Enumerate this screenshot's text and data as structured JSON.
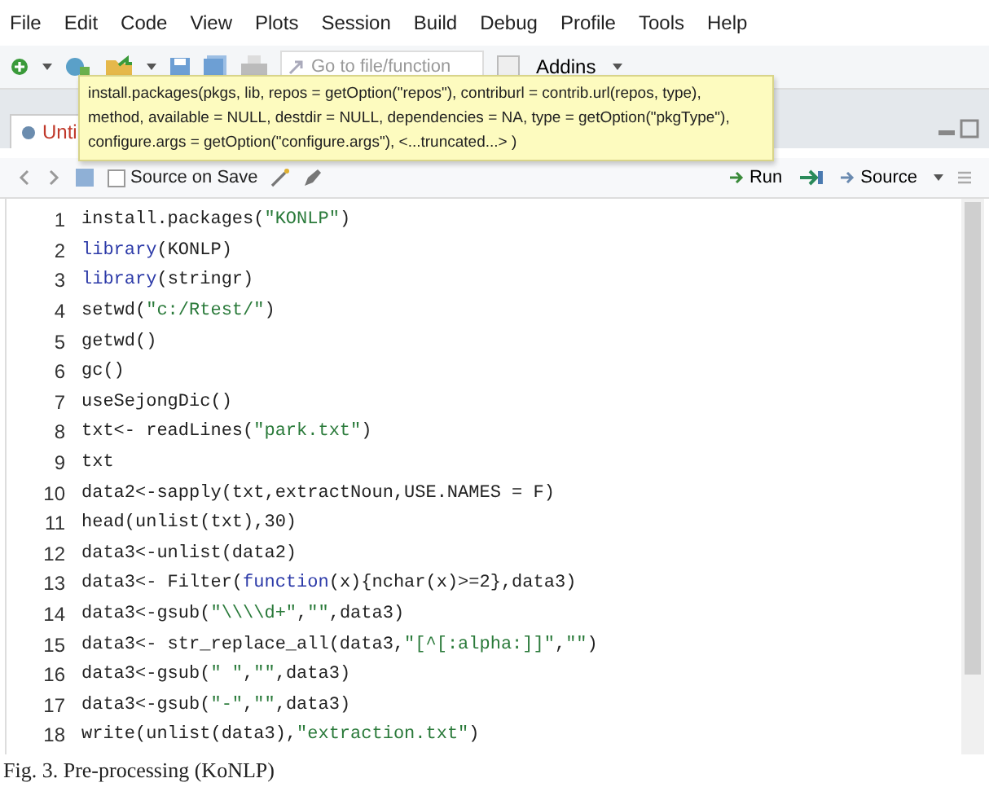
{
  "menu": [
    "File",
    "Edit",
    "Code",
    "View",
    "Plots",
    "Session",
    "Build",
    "Debug",
    "Profile",
    "Tools",
    "Help"
  ],
  "toolbar": {
    "search_placeholder": "Go to file/function",
    "addins": "Addins"
  },
  "tab": {
    "label": "Unti",
    "selected": true
  },
  "tooltip": [
    "install.packages(pkgs, lib, repos = getOption(\"repos\"), contriburl = contrib.url(repos, type),",
    "method, available = NULL, destdir = NULL, dependencies = NA, type = getOption(\"pkgType\"),",
    "configure.args = getOption(\"configure.args\"), <...truncated...> )"
  ],
  "editor_toolbar": {
    "source_on_save": "Source on Save",
    "source_on_save_checked": false,
    "run": "Run",
    "source": "Source"
  },
  "lines": [
    {
      "number": "1",
      "segments": [
        {
          "kind": "plain",
          "text": "install.packages("
        },
        {
          "kind": "string",
          "text": "\"KONLP\""
        },
        {
          "kind": "plain",
          "text": ")"
        }
      ]
    },
    {
      "number": "2",
      "segments": [
        {
          "kind": "keyword",
          "text": "library"
        },
        {
          "kind": "plain",
          "text": "(KONLP)"
        }
      ]
    },
    {
      "number": "3",
      "segments": [
        {
          "kind": "keyword",
          "text": "library"
        },
        {
          "kind": "plain",
          "text": "(stringr)"
        }
      ]
    },
    {
      "number": "4",
      "segments": [
        {
          "kind": "plain",
          "text": "setwd("
        },
        {
          "kind": "string",
          "text": "\"c:/Rtest/\""
        },
        {
          "kind": "plain",
          "text": ")"
        }
      ]
    },
    {
      "number": "5",
      "segments": [
        {
          "kind": "plain",
          "text": "getwd()"
        }
      ]
    },
    {
      "number": "6",
      "segments": [
        {
          "kind": "plain",
          "text": "gc()"
        }
      ]
    },
    {
      "number": "7",
      "segments": [
        {
          "kind": "plain",
          "text": "useSejongDic()"
        }
      ]
    },
    {
      "number": "8",
      "segments": [
        {
          "kind": "plain",
          "text": "txt<- readLines("
        },
        {
          "kind": "string",
          "text": "\"park.txt\""
        },
        {
          "kind": "plain",
          "text": ")"
        }
      ]
    },
    {
      "number": "9",
      "segments": [
        {
          "kind": "plain",
          "text": "txt"
        }
      ]
    },
    {
      "number": "10",
      "segments": [
        {
          "kind": "plain",
          "text": "data2<-sapply(txt,extractNoun,USE.NAMES = F)"
        }
      ]
    },
    {
      "number": "11",
      "segments": [
        {
          "kind": "plain",
          "text": "head(unlist(txt),30)"
        }
      ]
    },
    {
      "number": "12",
      "segments": [
        {
          "kind": "plain",
          "text": "data3<-unlist(data2)"
        }
      ]
    },
    {
      "number": "13",
      "segments": [
        {
          "kind": "plain",
          "text": "data3<- Filter("
        },
        {
          "kind": "keyword",
          "text": "function"
        },
        {
          "kind": "plain",
          "text": "(x){nchar(x)>=2},data3)"
        }
      ]
    },
    {
      "number": "14",
      "segments": [
        {
          "kind": "plain",
          "text": "data3<-gsub("
        },
        {
          "kind": "string",
          "text": "\"\\\\\\\\d+\""
        },
        {
          "kind": "plain",
          "text": ","
        },
        {
          "kind": "string",
          "text": "\"\""
        },
        {
          "kind": "plain",
          "text": ",data3)"
        }
      ]
    },
    {
      "number": "15",
      "segments": [
        {
          "kind": "plain",
          "text": "data3<- str_replace_all(data3,"
        },
        {
          "kind": "string",
          "text": "\"[^[:alpha:]]\""
        },
        {
          "kind": "plain",
          "text": ","
        },
        {
          "kind": "string",
          "text": "\"\""
        },
        {
          "kind": "plain",
          "text": ")"
        }
      ]
    },
    {
      "number": "16",
      "segments": [
        {
          "kind": "plain",
          "text": "data3<-gsub("
        },
        {
          "kind": "string",
          "text": "\" \""
        },
        {
          "kind": "plain",
          "text": ","
        },
        {
          "kind": "string",
          "text": "\"\""
        },
        {
          "kind": "plain",
          "text": ",data3)"
        }
      ]
    },
    {
      "number": "17",
      "segments": [
        {
          "kind": "plain",
          "text": "data3<-gsub("
        },
        {
          "kind": "string",
          "text": "\"-\""
        },
        {
          "kind": "plain",
          "text": ","
        },
        {
          "kind": "string",
          "text": "\"\""
        },
        {
          "kind": "plain",
          "text": ",data3)"
        }
      ]
    },
    {
      "number": "18",
      "segments": [
        {
          "kind": "plain",
          "text": "write(unlist(data3),"
        },
        {
          "kind": "string",
          "text": "\"extraction.txt\""
        },
        {
          "kind": "plain",
          "text": ")"
        }
      ]
    }
  ],
  "caption": "Fig. 3. Pre-processing (KoNLP)"
}
